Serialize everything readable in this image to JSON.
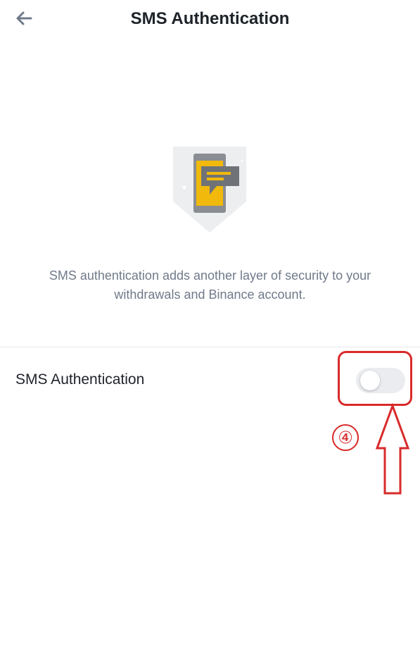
{
  "header": {
    "title": "SMS Authentication",
    "back_icon": "arrow-left-icon"
  },
  "hero": {
    "icon": "sms-phone-shield-icon",
    "colors": {
      "shield": "#eceef0",
      "phone": "#f0b90b",
      "phone_frame": "#8a8d92",
      "bubble": "#6f7378"
    }
  },
  "description": {
    "line1": "SMS authentication adds another layer of security to your",
    "line2": "withdrawals and Binance account."
  },
  "setting": {
    "label": "SMS Authentication",
    "enabled": false
  },
  "annotation": {
    "step": "④",
    "color": "#d92a2a"
  }
}
